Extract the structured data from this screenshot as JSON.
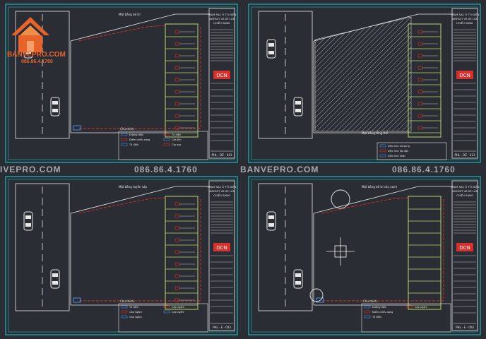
{
  "watermark": {
    "brand": "BANVEPRO.COM",
    "phone": "086.86.4.1760",
    "left_partial": "IVEPRO.COM",
    "phone_partial": "086.86.4.1760"
  },
  "logo": {
    "brand": "BANVEPRO.COM",
    "phone": "086.86.4.1760",
    "icon": "house-logo-icon"
  },
  "sheets": [
    {
      "id": "sheet-1",
      "code": "PHL - DZ - 401",
      "company_logo": "DCN",
      "title_lines": [
        "TRẠM SẠC Ô TÔ ĐIỆN",
        "VINFAST VÀ XE LĂN",
        "CHIẾU SÁNG"
      ],
      "legend_title": "Chú thích:",
      "legend_items": [
        "Đường điện",
        "Điểm chiếu sáng",
        "Tủ điện",
        "Tủ điện",
        "Cột đèn",
        "Cọc sạc"
      ],
      "plan_label": "Mặt bằng bố trí"
    },
    {
      "id": "sheet-2",
      "code": "PHL - DZ - 413",
      "company_logo": "DCN",
      "title_lines": [
        "TRẠM SẠC Ô TÔ ĐIỆN",
        "VINFAST VÀ XE LĂN",
        "CHIẾU SÁNG"
      ],
      "legend_items": [
        "Diện tích sử dụng",
        "Diện tích lắp đặt",
        "Diện tích khác"
      ],
      "plan_label": "Mặt bằng tổng thể"
    },
    {
      "id": "sheet-3",
      "code": "PHL - E - 003",
      "company_logo": "DCN",
      "title_lines": [
        "TRẠM SẠC Ô TÔ ĐIỆN",
        "VINFAST VÀ XE LĂN",
        "CHIẾU SÁNG"
      ],
      "legend_title": "Chú thích:",
      "legend_items": [
        "Tủ điện",
        "Cáp ngầm",
        "Cáp ngầm",
        "Cáp ngầm",
        "Cáp ngầm"
      ],
      "plan_label": "Mặt bằng tuyến cáp"
    },
    {
      "id": "sheet-4",
      "code": "PHL - E - 004",
      "company_logo": "DCN",
      "title_lines": [
        "TRẠM SẠC Ô TÔ ĐIỆN",
        "VINFAST VÀ XE LĂN",
        "CHIẾU SÁNG"
      ],
      "legend_title": "Chú thích:",
      "legend_items": [
        "Đường điện",
        "Điểm chiếu sáng",
        "Tủ điện",
        "Cáp ngầm"
      ],
      "plan_label": "Mặt bằng bố trí cây xanh"
    }
  ],
  "colors": {
    "background": "#2a2d33",
    "frame": "#1f9a9e",
    "line": "#e8e8e8",
    "cable": "#d9302c",
    "charger": "#b8d86b",
    "logo": "#e8632a",
    "watermark": "#cfd3da"
  }
}
